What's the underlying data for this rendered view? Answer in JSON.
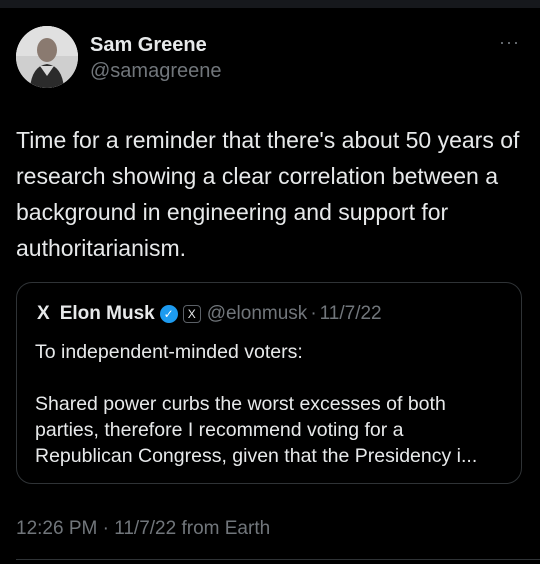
{
  "tweet": {
    "author_name": "Sam Greene",
    "author_handle": "@samagreene",
    "more_icon": "···",
    "text": "Time for a reminder that there's about 50 years of research showing a clear correlation between a background in engineering and support for authoritarianism.",
    "meta": "12:26 PM · 11/7/22 from Earth"
  },
  "quoted": {
    "avatar_glyph": "X",
    "author_name": "Elon Musk",
    "verified_glyph": "✓",
    "affiliate_glyph": "X",
    "author_handle": "@elonmusk",
    "separator": "·",
    "date": "11/7/22",
    "line1": "To independent-minded voters:",
    "line2": "Shared power curbs the worst excesses of both parties, therefore I recommend voting for a Republican Congress, given that the Presidency i..."
  },
  "colors": {
    "background": "#000000",
    "text": "#e7e9ea",
    "muted": "#71767b",
    "verified": "#1d9bf0",
    "border": "#2f3336"
  }
}
